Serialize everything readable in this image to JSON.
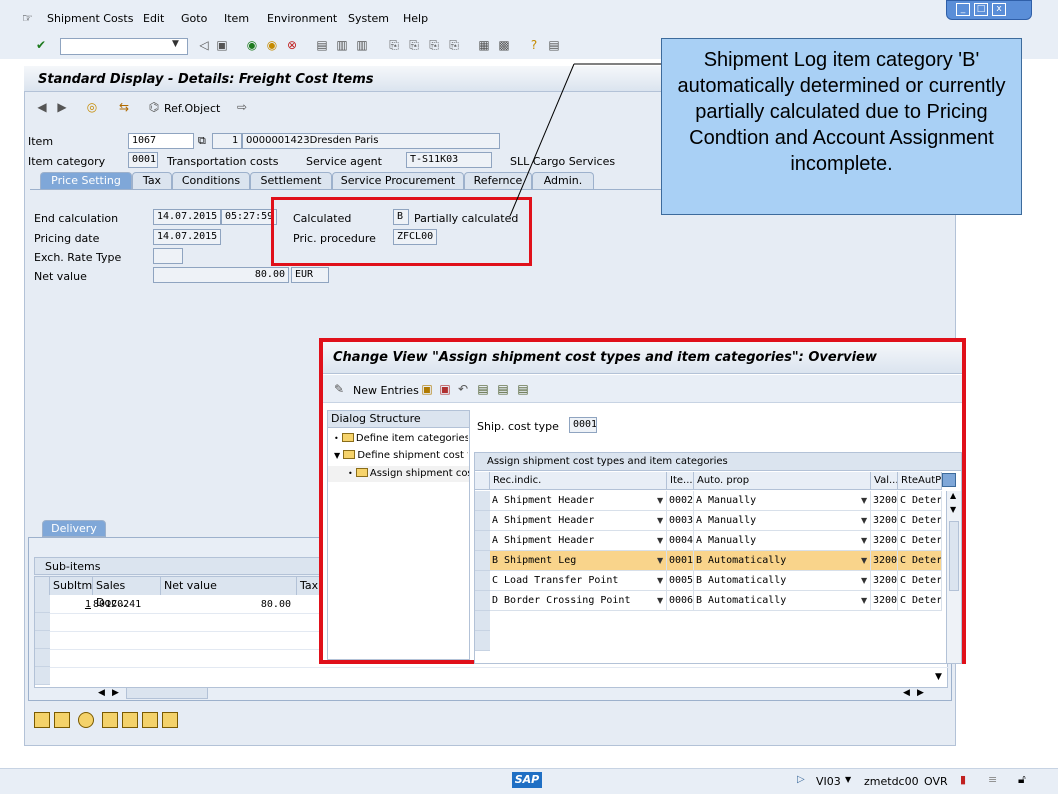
{
  "menu": [
    "Shipment Costs",
    "Edit",
    "Goto",
    "Item",
    "Environment",
    "System",
    "Help"
  ],
  "main": {
    "title": "Standard Display - Details: Freight Cost Items",
    "ref_object": "Ref.Object",
    "item_label": "Item",
    "item_value": "1067",
    "item_count": "1",
    "item_desc": "0000001423Dresden Paris",
    "category_label": "Item category",
    "category_value": "0001",
    "category_desc": "Transportation costs",
    "agent_label": "Service agent",
    "agent_value": "T-S11K03",
    "agent_desc": "SLL Cargo Services",
    "tabs": [
      "Price Setting",
      "Tax",
      "Conditions",
      "Settlement",
      "Service Procurement",
      "Refernce",
      "Admin."
    ],
    "end_calc_label": "End calculation",
    "end_calc_date": "14.07.2015",
    "end_calc_time": "05:27:59",
    "pricing_date_label": "Pricing date",
    "pricing_date": "14.07.2015",
    "exch_label": "Exch. Rate Type",
    "net_label": "Net value",
    "net_value": "80.00",
    "currency": "EUR",
    "calculated_label": "Calculated",
    "calculated_value": "B",
    "calculated_desc": "Partially calculated",
    "procedure_label": "Pric. procedure",
    "procedure_value": "ZFCL00"
  },
  "callout": "Shipment Log item category 'B' automatically determined or currently partially calculated due to Pricing Condtion and Account Assignment incomplete.",
  "delivery": {
    "tab": "Delivery",
    "subitems_title": "Sub-items",
    "columns": [
      "SubItm",
      "Sales Doc...",
      "Net value",
      "Tax"
    ],
    "rows": [
      {
        "subitm": "1",
        "sales_doc": "80120241",
        "net_value": "80.00"
      }
    ]
  },
  "popup": {
    "title": "Change View \"Assign shipment cost types and item categories\": Overview",
    "new_entries": "New Entries",
    "dialog_header": "Dialog Structure",
    "tree": [
      "Define item categories",
      "Define shipment cost typ",
      "Assign shipment cost"
    ],
    "ship_cost_label": "Ship. cost type",
    "ship_cost_value": "0001",
    "grid_title": "Assign shipment cost types and item categories",
    "columns": [
      "Rec.indic.",
      "Ite...",
      "Auto. prop",
      "Val...",
      "RteAutPr"
    ],
    "rows": [
      {
        "rec": "A Shipment Header",
        "item": "0002",
        "auto": "A Manually",
        "val": "3200",
        "rte": "C Deter"
      },
      {
        "rec": "A Shipment Header",
        "item": "0003",
        "auto": "A Manually",
        "val": "3200",
        "rte": "C Deter"
      },
      {
        "rec": "A Shipment Header",
        "item": "0004",
        "auto": "A Manually",
        "val": "3200",
        "rte": "C Deter"
      },
      {
        "rec": "B Shipment Leg",
        "item": "0001",
        "auto": "B Automatically",
        "val": "3200",
        "rte": "C Deter"
      },
      {
        "rec": "C Load Transfer Point",
        "item": "0005",
        "auto": "B Automatically",
        "val": "3200",
        "rte": "C Deter"
      },
      {
        "rec": "D Border Crossing Point",
        "item": "0006",
        "auto": "B Automatically",
        "val": "3200",
        "rte": "C Deter"
      }
    ]
  },
  "status": {
    "sap": "SAP",
    "system": "VI03",
    "client": "zmetdc00",
    "mode": "OVR"
  }
}
